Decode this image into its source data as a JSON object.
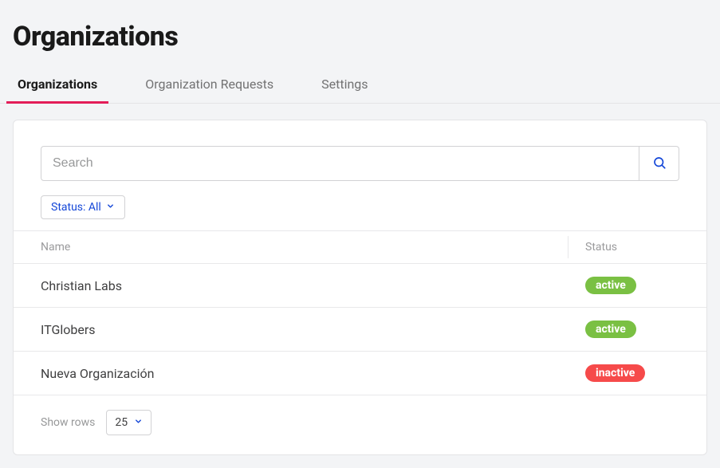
{
  "page_title": "Organizations",
  "tabs": [
    {
      "label": "Organizations",
      "id": "organizations",
      "active": true
    },
    {
      "label": "Organization Requests",
      "id": "requests",
      "active": false
    },
    {
      "label": "Settings",
      "id": "settings",
      "active": false
    }
  ],
  "search": {
    "placeholder": "Search",
    "value": ""
  },
  "filter": {
    "label": "Status: All"
  },
  "columns": {
    "name": "Name",
    "status": "Status"
  },
  "rows": [
    {
      "name": "Christian Labs",
      "status_label": "active",
      "status": "active"
    },
    {
      "name": "ITGlobers",
      "status_label": "active",
      "status": "active"
    },
    {
      "name": "Nueva Organización",
      "status_label": "inactive",
      "status": "inactive"
    }
  ],
  "pager": {
    "show_rows_label": "Show rows",
    "page_size": "25"
  }
}
